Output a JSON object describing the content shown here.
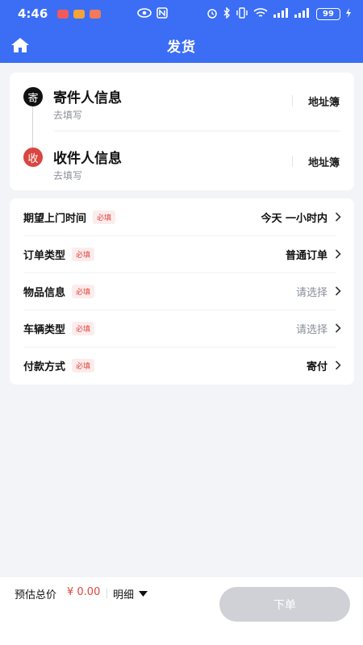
{
  "status_bar": {
    "time": "4:46",
    "battery": "99",
    "signal_text": "..ıl ..ıl"
  },
  "header": {
    "title": "发货",
    "home_icon": "home-icon"
  },
  "colors": {
    "brand": "#3b6ef5",
    "required": "#e0443e",
    "sender_badge": "#111111",
    "receiver_badge": "#d9463f",
    "button_disabled": "#cfd1d6"
  },
  "address": {
    "sender": {
      "badge": "寄",
      "title": "寄件人信息",
      "subtitle": "去填写",
      "book_label": "地址簿"
    },
    "receiver": {
      "badge": "收",
      "title": "收件人信息",
      "subtitle": "去填写",
      "book_label": "地址簿"
    }
  },
  "form": {
    "required_label": "必填",
    "rows": [
      {
        "label": "期望上门时间",
        "value": "今天 一小时内",
        "filled": true
      },
      {
        "label": "订单类型",
        "value": "普通订单",
        "filled": true
      },
      {
        "label": "物品信息",
        "value": "请选择",
        "filled": false
      },
      {
        "label": "车辆类型",
        "value": "请选择",
        "filled": false
      },
      {
        "label": "付款方式",
        "value": "寄付",
        "filled": true
      }
    ]
  },
  "footer": {
    "price_label": "预估总价",
    "price_value": "¥ 0.00",
    "detail_label": "明细",
    "submit_label": "下单"
  }
}
